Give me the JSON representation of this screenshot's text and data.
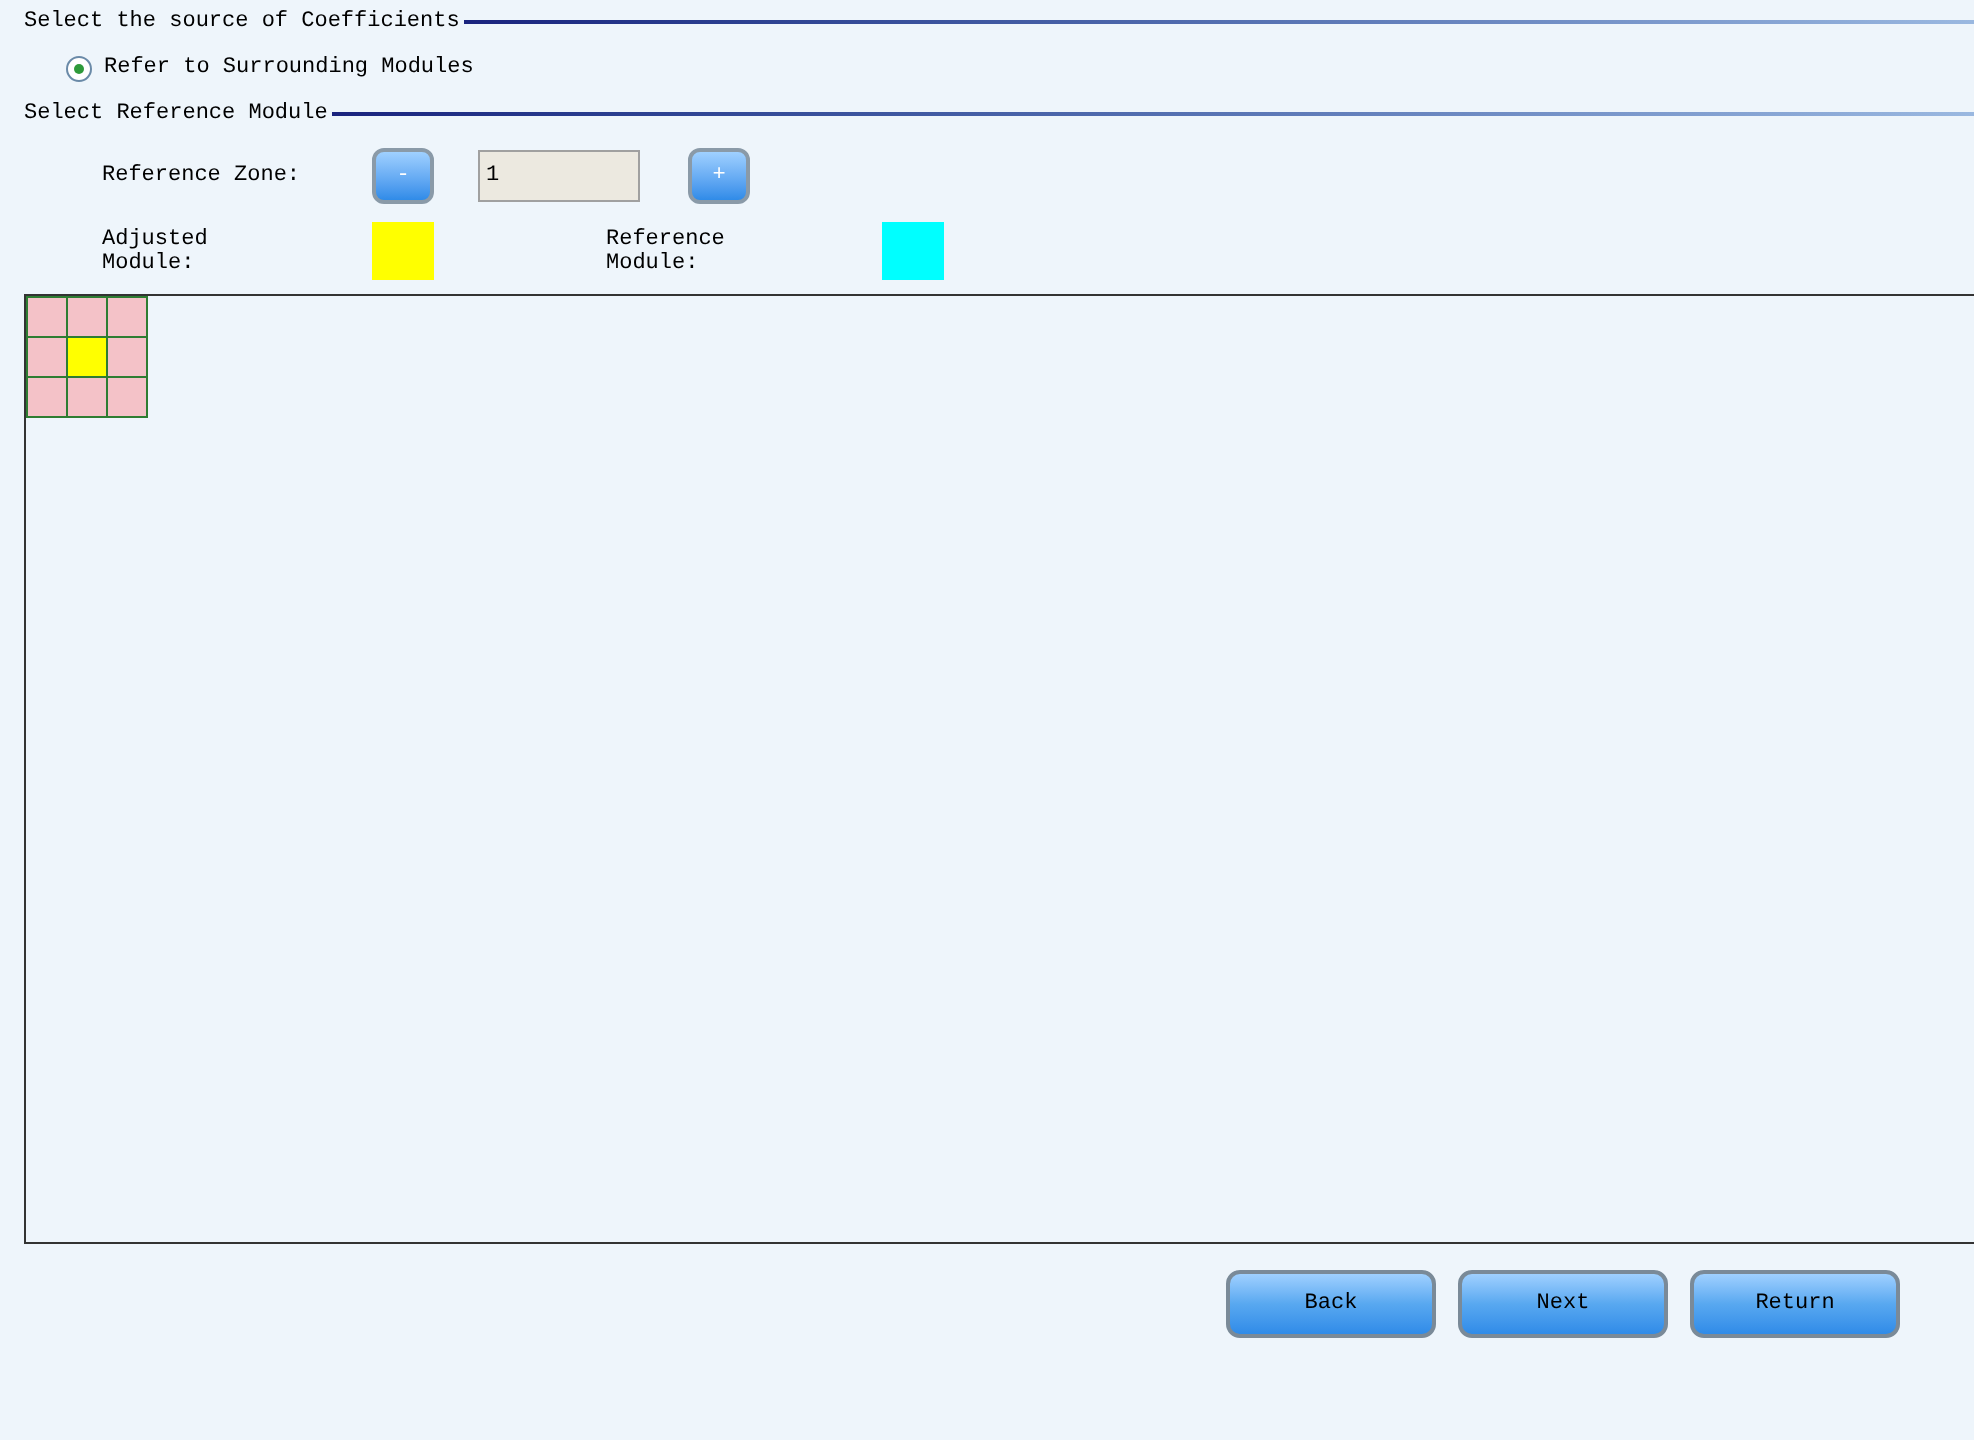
{
  "sections": [
    {
      "title": "Select the source of Coefficients"
    },
    {
      "title": "Select Reference Module"
    }
  ],
  "source_option": {
    "label": "Refer to Surrounding Modules",
    "selected": true
  },
  "reference_zone": {
    "label": "Reference Zone:",
    "decrement": "-",
    "value": "1",
    "increment": "+"
  },
  "legend": [
    {
      "label": "Adjusted Module:",
      "color": "#ffff00"
    },
    {
      "label": "Reference Module:",
      "color": "#00ffff"
    }
  ],
  "module_grid": [
    [
      {
        "color": "#f4c2c8"
      },
      {
        "color": "#f4c2c8"
      },
      {
        "color": "#f4c2c8"
      }
    ],
    [
      {
        "color": "#f4c2c8"
      },
      {
        "color": "#ffff00"
      },
      {
        "color": "#f4c2c8"
      }
    ],
    [
      {
        "color": "#f4c2c8"
      },
      {
        "color": "#f4c2c8"
      },
      {
        "color": "#f4c2c8"
      }
    ]
  ],
  "buttons": [
    "Back",
    "Next",
    "Return"
  ]
}
